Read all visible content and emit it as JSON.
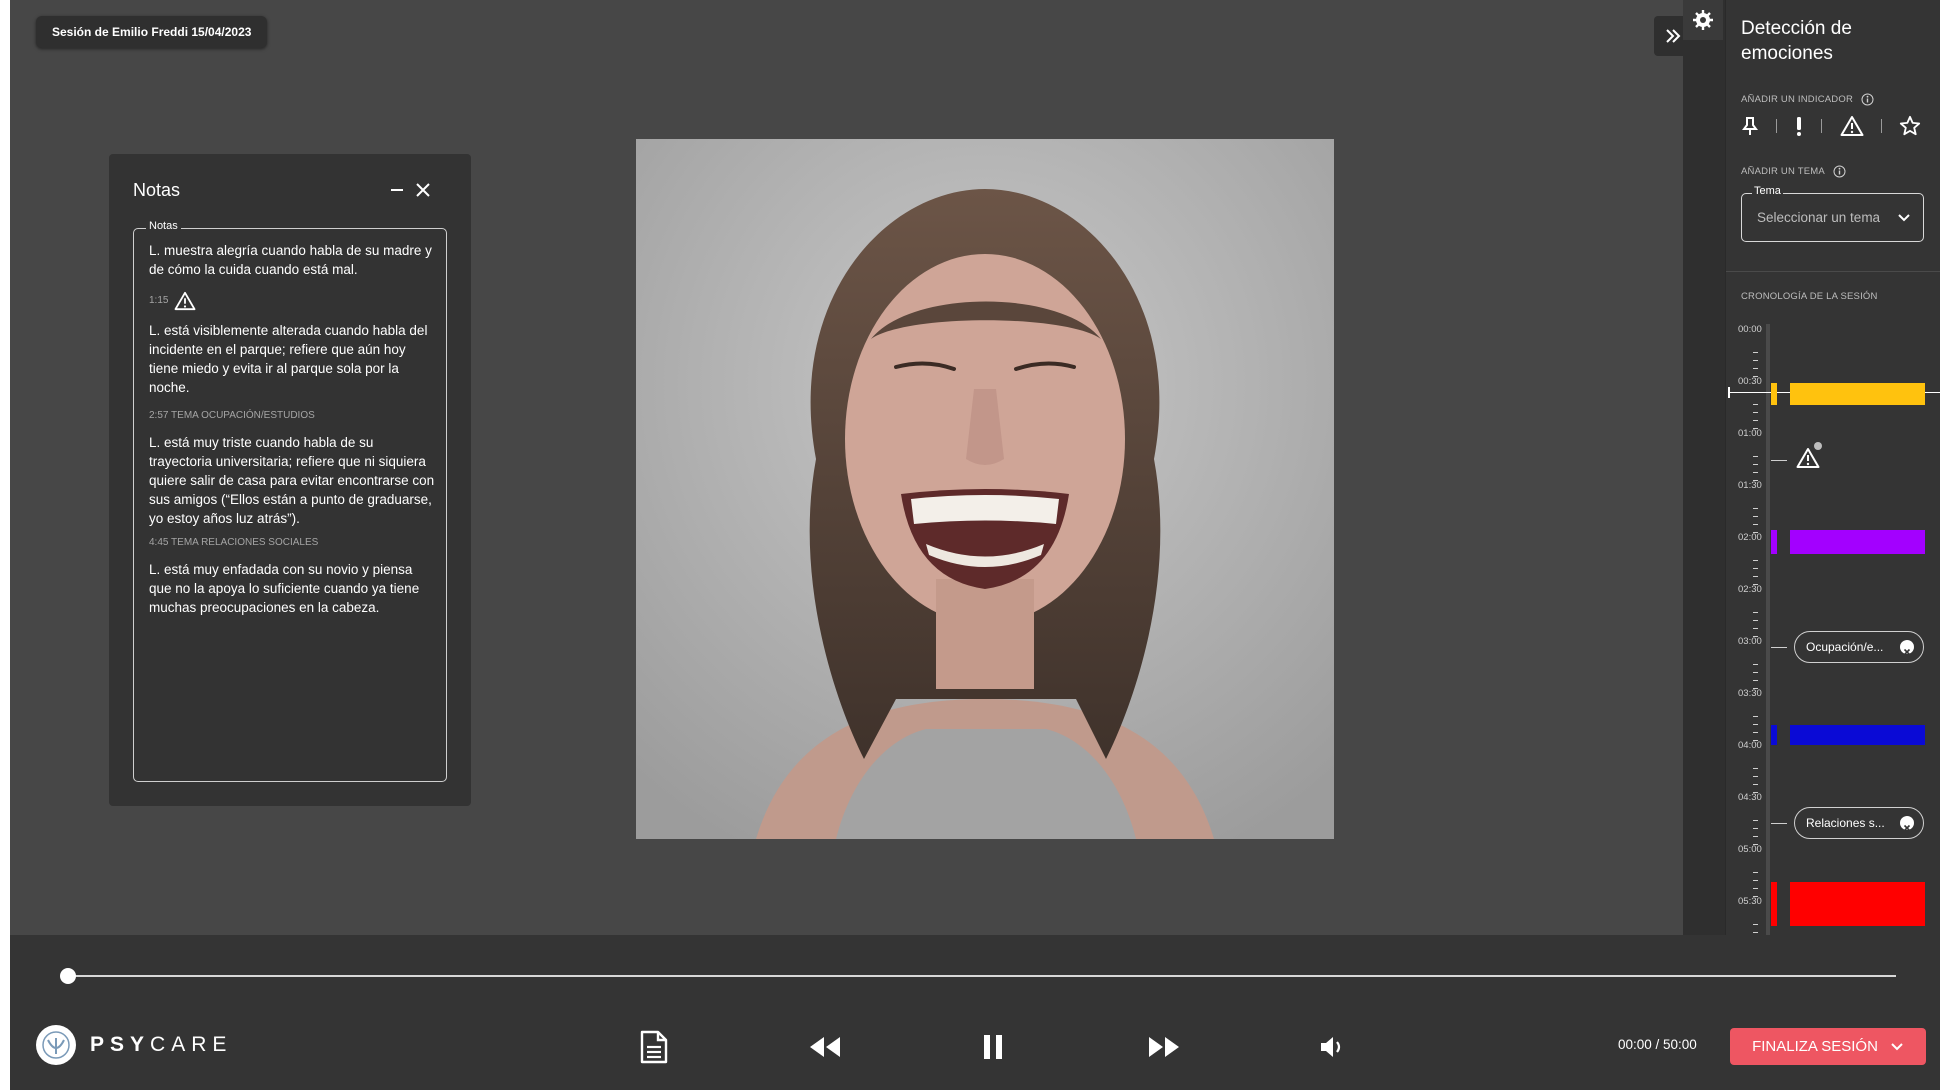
{
  "session": {
    "label": "Sesión de Emilio Freddi 15/04/2023"
  },
  "notes": {
    "title": "Notas",
    "field_label": "Notas",
    "entries": [
      {
        "meta": "",
        "text": "L. muestra alegría cuando habla de su madre y de cómo la cuida cuando está mal."
      },
      {
        "meta": "1:15",
        "icon": "warning-icon",
        "text": "L. está visiblemente alterada cuando habla del incidente en el parque; refiere que aún hoy tiene miedo y evita ir al parque sola por la noche."
      },
      {
        "meta": "2:57 TEMA OCUPACIÓN/ESTUDIOS",
        "text": "L. está muy triste cuando habla de su trayectoria universitaria; refiere que ni siquiera quiere salir de casa para evitar encontrarse con sus amigos (“Ellos están a punto de graduarse, yo estoy años luz atrás”)."
      },
      {
        "meta": "4:45 TEMA RELACIONES SOCIALES",
        "text": "L. está muy enfadada con su novio y piensa que no la apoya lo suficiente cuando ya tiene muchas preocupaciones en la cabeza."
      }
    ]
  },
  "panel": {
    "title": "Detección de emociones",
    "add_indicator_label": "AÑADIR UN INDICADOR",
    "indicator_icons": [
      "pin-icon",
      "exclamation-icon",
      "warning-icon",
      "star-icon"
    ],
    "add_topic_label": "AÑADIR UN TEMA",
    "topic_field_label": "Tema",
    "topic_placeholder": "Seleccionar un tema",
    "timeline_label": "CRONOLOGÍA DE LA SESIÓN",
    "timeline_times": [
      "00:00",
      "00:30",
      "01:00",
      "01:30",
      "02:00",
      "02:30",
      "03:00",
      "03:30",
      "04:00",
      "04:30",
      "05:00",
      "05:30"
    ],
    "topic_chips": [
      "Ocupación/e...",
      "Relaciones s..."
    ],
    "emotion_colors": {
      "yellow": "#ffc20e",
      "purple": "#a300ff",
      "blue": "#0a0ad6",
      "red": "#ff0000"
    }
  },
  "player": {
    "progress_fraction": 0,
    "time_readout": "00:00 / 50:00",
    "finish_label": "FINALIZA SESIÓN"
  },
  "brand": {
    "name_bold": "PSY",
    "name_light": "CARE"
  }
}
